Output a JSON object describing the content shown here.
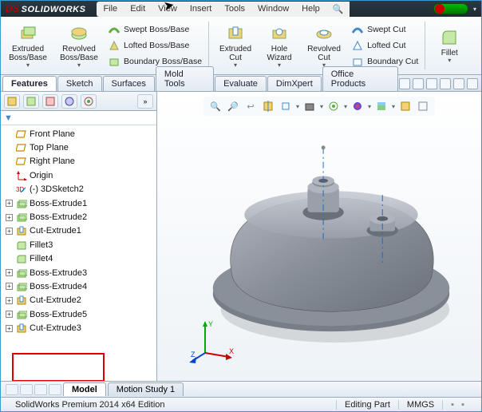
{
  "app": {
    "brand": "SOLIDWORKS"
  },
  "menu": [
    "File",
    "Edit",
    "View",
    "Insert",
    "Tools",
    "Window",
    "Help"
  ],
  "ribbon": {
    "extruded_boss": "Extruded Boss/Base",
    "revolved_boss": "Revolved Boss/Base",
    "swept_boss": "Swept Boss/Base",
    "lofted_boss": "Lofted Boss/Base",
    "boundary_boss": "Boundary Boss/Base",
    "extruded_cut": "Extruded Cut",
    "hole_wizard": "Hole Wizard",
    "revolved_cut": "Revolved Cut",
    "swept_cut": "Swept Cut",
    "lofted_cut": "Lofted Cut",
    "boundary_cut": "Boundary Cut",
    "fillet": "Fillet"
  },
  "command_tabs": [
    "Features",
    "Sketch",
    "Surfaces",
    "Mold Tools",
    "Evaluate",
    "DimXpert",
    "Office Products"
  ],
  "tree": [
    {
      "icon": "plane",
      "label": "Front Plane",
      "exp": ""
    },
    {
      "icon": "plane",
      "label": "Top Plane",
      "exp": ""
    },
    {
      "icon": "plane",
      "label": "Right Plane",
      "exp": ""
    },
    {
      "icon": "origin",
      "label": "Origin",
      "exp": ""
    },
    {
      "icon": "sketch3d",
      "label": "(-) 3DSketch2",
      "exp": ""
    },
    {
      "icon": "boss",
      "label": "Boss-Extrude1",
      "exp": "+"
    },
    {
      "icon": "boss",
      "label": "Boss-Extrude2",
      "exp": "+"
    },
    {
      "icon": "cut",
      "label": "Cut-Extrude1",
      "exp": "+"
    },
    {
      "icon": "fillet",
      "label": "Fillet3",
      "exp": ""
    },
    {
      "icon": "fillet",
      "label": "Fillet4",
      "exp": ""
    },
    {
      "icon": "boss",
      "label": "Boss-Extrude3",
      "exp": "+"
    },
    {
      "icon": "boss",
      "label": "Boss-Extrude4",
      "exp": "+"
    },
    {
      "icon": "cut",
      "label": "Cut-Extrude2",
      "exp": "+"
    },
    {
      "icon": "boss",
      "label": "Boss-Extrude5",
      "exp": "+"
    },
    {
      "icon": "cut",
      "label": "Cut-Extrude3",
      "exp": "+"
    }
  ],
  "bottom_tabs": [
    "Model",
    "Motion Study 1"
  ],
  "status": {
    "left": "SolidWorks Premium 2014 x64 Edition",
    "mode": "Editing Part",
    "units": "MMGS"
  },
  "triad": {
    "x": "X",
    "y": "Y",
    "z": "Z"
  }
}
